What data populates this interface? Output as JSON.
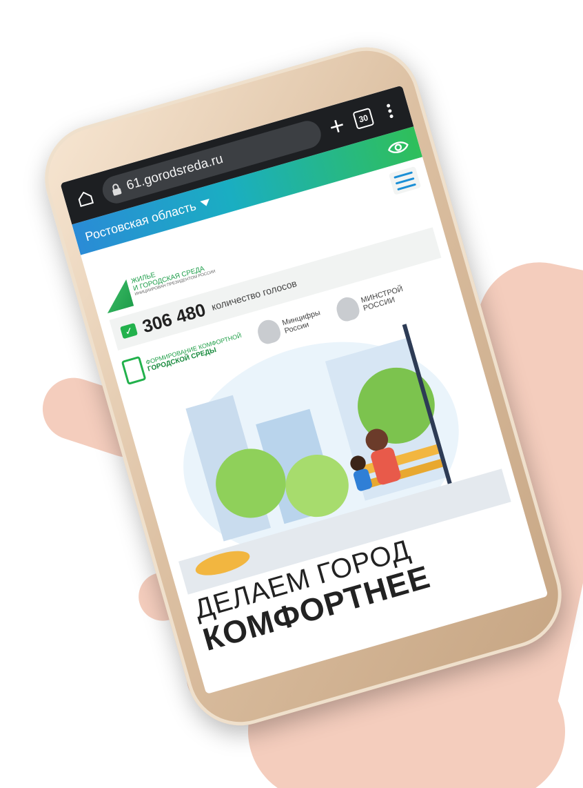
{
  "browser": {
    "url": "61.gorodsreda.ru",
    "tab_count": "30"
  },
  "site": {
    "region": "Ростовская область",
    "logo_line1": "ЖИЛЬЕ",
    "logo_line2": "И ГОРОДСКАЯ СРЕДА",
    "logo_tagline": "ИНИЦИИРОВАН ПРЕЗИДЕНТОМ РОССИИ",
    "votes_count": "306 480",
    "votes_label": "количество голосов",
    "partners": [
      {
        "name": "ФОРМИРОВАНИЕ КОМФОРТНОЙ",
        "sub": "ГОРОДСКОЙ СРЕДЫ"
      },
      {
        "name": "Минцифры",
        "sub": "России"
      },
      {
        "name": "МИНСТРОЙ",
        "sub": "РОССИИ"
      }
    ],
    "headline_line1": "ДЕЛАЕМ ГОРОД",
    "headline_line2": "КОМФОРТНЕЕ"
  },
  "icons": [
    "home-icon",
    "lock-icon",
    "plus-icon",
    "tabs-icon",
    "more-icon",
    "dropdown-icon",
    "eye-icon",
    "menu-icon",
    "check-icon",
    "emblem-icon"
  ],
  "colors": {
    "topbar": "#1d1f22",
    "region_start": "#2a8bd6",
    "region_end": "#2fbf5a",
    "accent_green": "#22b14c",
    "menu_blue": "#1b8fd6"
  }
}
